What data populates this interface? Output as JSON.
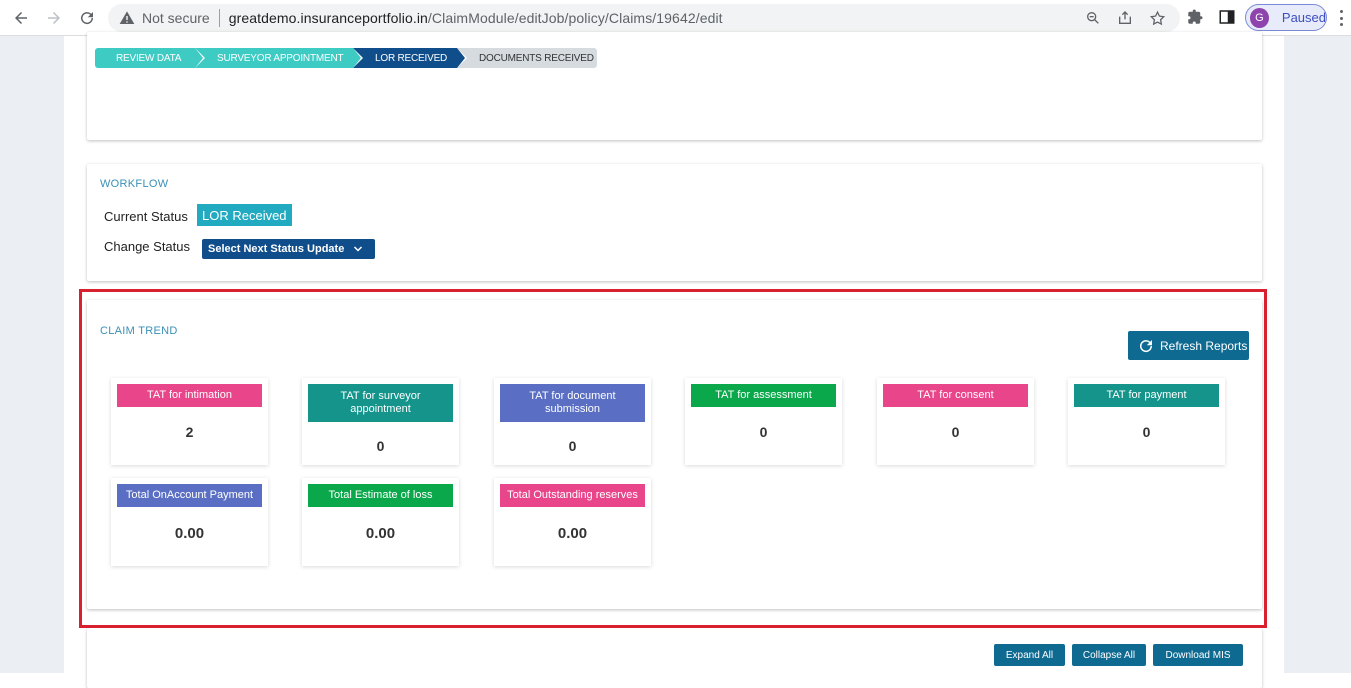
{
  "browser": {
    "security_label": "Not secure",
    "url_host": "greatdemo.insuranceportfolio.in",
    "url_path": "/ClaimModule/editJob/policy/Claims/19642/edit",
    "profile_initial": "G",
    "profile_status": "Paused"
  },
  "stepper": {
    "steps": [
      "REVIEW DATA",
      "SURVEYOR APPOINTMENT",
      "LOR RECEIVED",
      "DOCUMENTS RECEIVED"
    ]
  },
  "workflow": {
    "title": "WORKFLOW",
    "current_status_label": "Current Status",
    "current_status_value": "LOR Received",
    "change_status_label": "Change Status",
    "change_status_select": "Select Next Status Update"
  },
  "claim_trend": {
    "title": "CLAIM TREND",
    "refresh_label": "Refresh Reports",
    "cards": [
      {
        "label": "TAT for intimation",
        "value": "2",
        "color": "#e8458b"
      },
      {
        "label": "TAT for surveyor appointment",
        "value": "0",
        "color": "#14948a"
      },
      {
        "label": "TAT for document submission",
        "value": "0",
        "color": "#5a6fc4"
      },
      {
        "label": "TAT for assessment",
        "value": "0",
        "color": "#0aa84a"
      },
      {
        "label": "TAT for consent",
        "value": "0",
        "color": "#e8458b"
      },
      {
        "label": "TAT for payment",
        "value": "0",
        "color": "#14948a"
      },
      {
        "label": "Total OnAccount Payment",
        "value": "0.00",
        "color": "#5a6fc4"
      },
      {
        "label": "Total Estimate of loss",
        "value": "0.00",
        "color": "#0aa84a"
      },
      {
        "label": "Total Outstanding reserves",
        "value": "0.00",
        "color": "#e8458b"
      }
    ]
  },
  "bottom_actions": {
    "expand_all": "Expand All",
    "collapse_all": "Collapse All",
    "download_mis": "Download MIS"
  }
}
